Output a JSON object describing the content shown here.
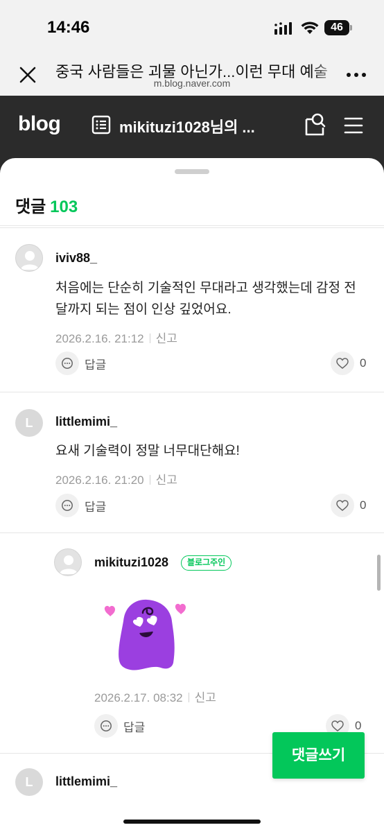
{
  "status_bar": {
    "time": "14:46",
    "battery": "46"
  },
  "browser": {
    "title": "중국 사람들은 괴물 아닌가...이런 무대 예술",
    "url": "m.blog.naver.com",
    "close_icon": "close-icon",
    "more_icon": "more-dots-icon"
  },
  "blog_nav": {
    "logo": "blog",
    "blog_name": "mikituzi1028님의 ..."
  },
  "comments": {
    "title": "댓글",
    "count": "103",
    "items": [
      {
        "username": "iviv88_",
        "text": "처음에는 단순히 기술적인 무대라고 생각했는데 감정 전달까지 되는 점이 인상 깊었어요.",
        "date": "2026.2.16. 21:12",
        "report": "신고",
        "reply": "답글",
        "likes": "0"
      },
      {
        "username": "littlemimi_",
        "avatar_letter": "L",
        "text": "요새 기술력이 정말 너무대단해요!",
        "date": "2026.2.16. 21:20",
        "report": "신고",
        "reply": "답글",
        "likes": "0"
      },
      {
        "username": "mikituzi1028",
        "badge": "블로그주인",
        "sticker": "purple-blob-heart-eyes-sticker",
        "date": "2026.2.17. 08:32",
        "report": "신고",
        "reply": "답글",
        "likes": "0"
      },
      {
        "username": "littlemimi_",
        "avatar_letter": "L"
      }
    ]
  },
  "write_button": "댓글쓰기",
  "colors": {
    "accent": "#03c75a",
    "nav_bg": "#2b2b2b",
    "sticker": "#9b3fe0"
  }
}
